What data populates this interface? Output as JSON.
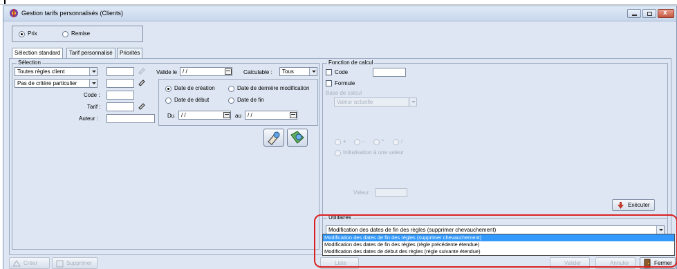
{
  "window": {
    "title": "Gestion tarifs personnalisés (Clients)"
  },
  "mode": {
    "prix_label": "Prix",
    "remise_label": "Remise",
    "selected": "Prix"
  },
  "tabs": [
    {
      "label": "Sélection standard",
      "active": true
    },
    {
      "label": "Tarif personnalisé",
      "active": false
    },
    {
      "label": "Priorités",
      "active": false
    }
  ],
  "selection": {
    "group_label": "Sélection",
    "combo1_value": "Toutes règles client",
    "combo2_value": "Pas de critère particulier",
    "code_label": "Code :",
    "tarif_label": "Tarif :",
    "auteur_label": "Auteur :",
    "valide_le_label": "Valide le",
    "valide_le_value": " / /",
    "calculable_label": "Calculable :",
    "calculable_value": "Tous",
    "date_creation_label": "Date de création",
    "date_modif_label": "Date de dernière modification",
    "date_debut_label": "Date de début",
    "date_fin_label": "Date de fin",
    "date_selected": "Date de création",
    "du_label": "Du",
    "du_value": " / /",
    "au_label": "au",
    "au_value": " / /"
  },
  "fonction": {
    "group_label": "Fonction de calcul",
    "code_label": "Code",
    "formule_label": "Formule",
    "base_label": "Base de calcul",
    "base_value": "Valeur actuelle",
    "ops": [
      "+",
      "-",
      "*",
      "/"
    ],
    "init_label": "Initialisation à une valeur",
    "valeur_label": "Valeur :",
    "executer_label": "Exécuter"
  },
  "utilitaires": {
    "group_label": "Utilitaires",
    "selected_value": "Modification des dates de fin des règles (supprimer chevauchement)",
    "options": [
      "Modification des dates de fin des règles (supprimer chevauchement)",
      "Modification des dates de fin des règles (règle précédente étendue)",
      "Modification des dates de début des règles (règle suivante étendue)"
    ]
  },
  "bottom": {
    "creer_label": "Créer",
    "supprimer_label": "Supprimer",
    "liste_label": "Liste",
    "valider_label": "Valider",
    "annuler_label": "Annuler",
    "fermer_label": "Fermer"
  },
  "colors": {
    "highlight": "#d92020",
    "selection": "#3399ff"
  }
}
